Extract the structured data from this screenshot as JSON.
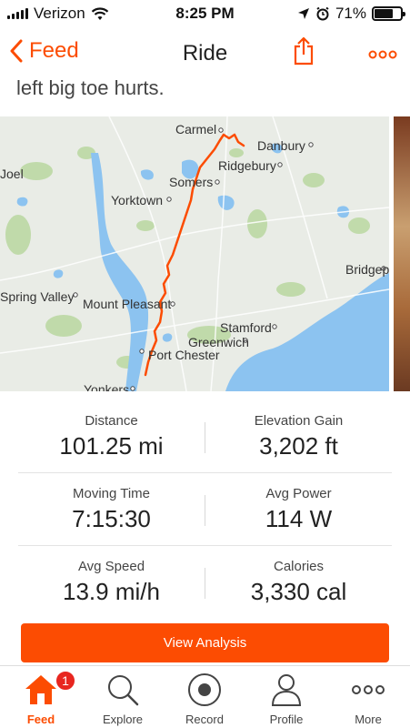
{
  "status_bar": {
    "carrier": "Verizon",
    "time": "8:25 PM",
    "battery": "71%",
    "battery_level": 0.71
  },
  "nav": {
    "back_label": "Feed",
    "title": "Ride"
  },
  "description_fragment": "left big toe hurts.",
  "map": {
    "labels": [
      "Carmel",
      "Danbury",
      "Joel",
      "Ridgebury",
      "Somers",
      "Yorktown",
      "Bridgep",
      "Spring Valley",
      "Mount Pleasant",
      "Stamford",
      "Greenwich",
      "Port Chester",
      "Yonkers"
    ]
  },
  "stats": {
    "distance_label": "Distance",
    "distance_value": "101.25 mi",
    "elevation_label": "Elevation Gain",
    "elevation_value": "3,202 ft",
    "moving_time_label": "Moving Time",
    "moving_time_value": "7:15:30",
    "avg_power_label": "Avg Power",
    "avg_power_value": "114 W",
    "avg_speed_label": "Avg Speed",
    "avg_speed_value": "13.9 mi/h",
    "calories_label": "Calories",
    "calories_value": "3,330 cal"
  },
  "analysis_button": "View Analysis",
  "tabs": [
    {
      "label": "Feed",
      "icon": "home-icon",
      "badge": "1"
    },
    {
      "label": "Explore",
      "icon": "search-icon"
    },
    {
      "label": "Record",
      "icon": "record-icon"
    },
    {
      "label": "Profile",
      "icon": "profile-icon"
    },
    {
      "label": "More",
      "icon": "more-icon"
    }
  ],
  "colors": {
    "accent": "#fc4c02",
    "badge": "#e8261f",
    "water": "#8cc3f0",
    "route": "#fc4c02"
  }
}
